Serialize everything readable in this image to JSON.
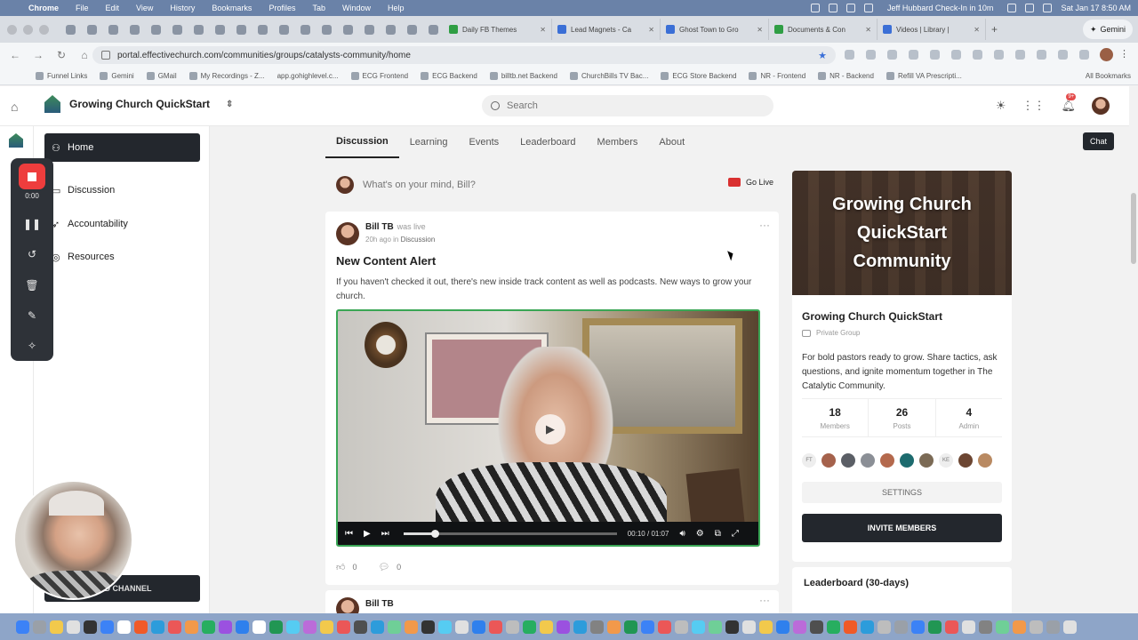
{
  "menubar": {
    "app": "Chrome",
    "items": [
      "File",
      "Edit",
      "View",
      "History",
      "Bookmarks",
      "Profiles",
      "Tab",
      "Window",
      "Help"
    ],
    "checkin": "Jeff Hubbard Check-In in 10m",
    "datetime": "Sat Jan 17  8:50 AM"
  },
  "tabs": [
    {
      "title": "Daily FB Themes",
      "color": "#2f9e44"
    },
    {
      "title": "Lead Magnets - Ca",
      "color": "#3b6fd6"
    },
    {
      "title": "Ghost Town to Gro",
      "color": "#3b6fd6"
    },
    {
      "title": "Documents & Con",
      "color": "#2f9e44"
    },
    {
      "title": "Videos | Library |",
      "color": "#3b6fd6"
    }
  ],
  "gemini_label": "Gemini",
  "address": {
    "url": "portal.effectivechurch.com/communities/groups/catalysts-community/home"
  },
  "bookmarks": [
    "Funnel Links",
    "Gemini",
    "GMail",
    "My Recordings - Z...",
    "app.gohighlevel.c...",
    "ECG Frontend",
    "ECG Backend",
    "billtb.net Backend",
    "ChurchBills TV Bac...",
    "ECG Store Backend",
    "NR - Frontend",
    "NR - Backend",
    "Refill VA Prescripti..."
  ],
  "all_bookmarks": "All Bookmarks",
  "header": {
    "group_name": "Growing Church QuickStart",
    "search_placeholder": "Search",
    "notif_badge": "9+"
  },
  "sidebar": {
    "items": [
      {
        "label": "Home",
        "icon": "user-icon"
      },
      {
        "label": "Discussion",
        "icon": "chat-icon"
      },
      {
        "label": "Accountability",
        "icon": "rocket-icon"
      },
      {
        "label": "Resources",
        "icon": "globe-icon"
      }
    ],
    "add_channel": "ADD CHANNEL"
  },
  "recorder": {
    "time": "0:00"
  },
  "main_tabs": [
    "Discussion",
    "Learning",
    "Events",
    "Leaderboard",
    "Members",
    "About"
  ],
  "chat_label": "Chat",
  "composer": {
    "placeholder": "What's on your mind, Bill?",
    "go_live": "Go Live"
  },
  "post": {
    "author": "Bill TB",
    "status": "was live",
    "time": "20h ago in",
    "channel": "Discussion",
    "title": "New Content Alert",
    "body": "If you haven't checked it out, there's new inside track content as well as podcasts. New ways to grow your church.",
    "video": {
      "current": "00:10",
      "separator": "/",
      "duration": "01:07",
      "progress": 0.149
    },
    "likes": "0",
    "comments": "0"
  },
  "post2": {
    "author": "Bill TB"
  },
  "group_card": {
    "hero_text": "Growing Church QuickStart Community",
    "name": "Growing Church QuickStart",
    "privacy": "Private Group",
    "description": "For bold pastors ready to grow. Share tactics, ask questions, and ignite momentum together in The Catalytic Community.",
    "stats": [
      {
        "value": "18",
        "label": "Members"
      },
      {
        "value": "26",
        "label": "Posts"
      },
      {
        "value": "4",
        "label": "Admin"
      }
    ],
    "member_initials": [
      "FT",
      "KE"
    ],
    "settings_label": "SETTINGS",
    "invite_label": "INVITE MEMBERS"
  },
  "leaderboard_title": "Leaderboard (30-days)"
}
